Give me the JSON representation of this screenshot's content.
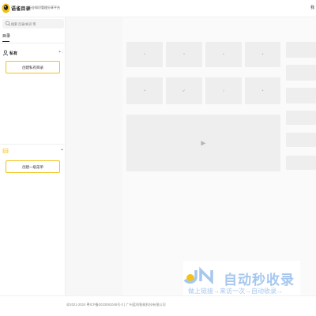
{
  "header": {
    "brand": "语雀目录",
    "tagline": "行业知识管理分享平台",
    "right_label": "我"
  },
  "sidebar": {
    "search": {
      "placeholder": "搜索 目录/知识 等"
    },
    "tab": "目录",
    "private_section": {
      "title": "私有",
      "actions": "+ :",
      "create_button": "创建私有目录"
    },
    "shared_section": {
      "title": "",
      "actions": "+",
      "create_button": "创建一级菜单"
    }
  },
  "main": {
    "tile_glyph_a": "▪",
    "tile_glyph_b": "↙",
    "tile_glyph_c": "♪",
    "big_glyph": "▶"
  },
  "watermark": {
    "main": "自动秒收录",
    "sub": "做上链接→来访一次→自动收录→"
  },
  "footer": {
    "text": "@2021-2024 粤ICP备2023081048号-2 | 广州蓝科智能科技有限公司"
  },
  "colors": {
    "accent": "#f2c21a",
    "watermark": "#a6c7ef"
  }
}
